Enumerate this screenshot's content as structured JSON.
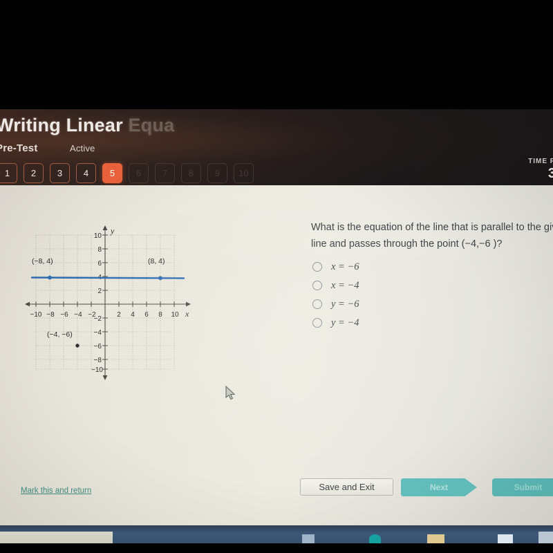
{
  "header": {
    "course_title_visible": "Writing Linear",
    "course_title_faded": " Equa",
    "assignment_label": "Pre-Test",
    "status_label": "Active",
    "timer_label": "TIME R",
    "timer_value": "3",
    "question_numbers": [
      "1",
      "2",
      "3",
      "4",
      "5",
      "6",
      "7",
      "8",
      "9",
      "10"
    ],
    "current_question": "5"
  },
  "question": {
    "text": "What is the equation of the line that is parallel to the giv line and passes through the point (−4,−6 )?",
    "choices": [
      {
        "label": "x = −6",
        "selected": false
      },
      {
        "label": "x = −4",
        "selected": false
      },
      {
        "label": "y = −6",
        "selected": false
      },
      {
        "label": "y = −4",
        "selected": false
      }
    ]
  },
  "footer": {
    "mark_link": "Mark this and return",
    "save_exit": "Save and Exit",
    "next": "Next",
    "submit": "Submit"
  },
  "colors": {
    "accent_orange": "#e8613a",
    "line_blue": "#2f6fb5",
    "teal_button": "#63c3c0",
    "link_teal": "#3f8f86",
    "sheet_bg": "#eceadf"
  },
  "chart_data": {
    "type": "line",
    "title": "",
    "xlabel": "x",
    "ylabel": "y",
    "xlim": [
      -11,
      11
    ],
    "ylim": [
      -11,
      11
    ],
    "xticks": [
      -10,
      -8,
      -6,
      -4,
      -2,
      2,
      4,
      6,
      8,
      10
    ],
    "yticks": [
      10,
      8,
      6,
      4,
      2,
      -2,
      -4,
      -6,
      -8,
      -10
    ],
    "grid": true,
    "grid_step": 2,
    "series": [
      {
        "name": "given line",
        "type": "line",
        "color": "#2f6fb5",
        "equation": "y = 4",
        "x": [
          -10,
          10
        ],
        "y": [
          4,
          4
        ],
        "markers": [
          {
            "x": -8,
            "y": 4,
            "label": "(−8, 4)"
          },
          {
            "x": 8,
            "y": 4,
            "label": "(8, 4)"
          }
        ]
      },
      {
        "name": "given point",
        "type": "scatter",
        "color": "#333333",
        "x": [
          -4
        ],
        "y": [
          -6
        ],
        "markers": [
          {
            "x": -4,
            "y": -6,
            "label": "(−4, −6)"
          }
        ]
      }
    ]
  }
}
